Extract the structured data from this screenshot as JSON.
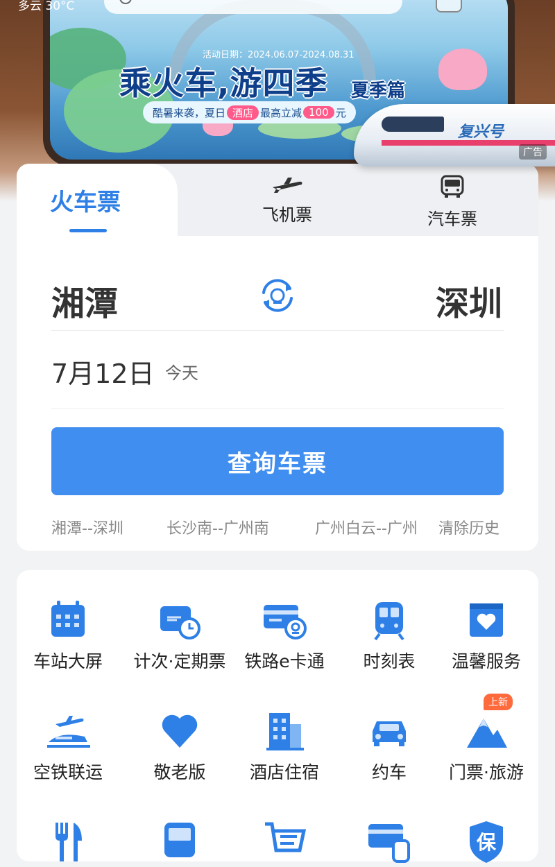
{
  "status": {
    "weather": "多云 30°C"
  },
  "banner": {
    "date_range": "活动日期：2024.06.07-2024.08.31",
    "title": "乘火车,游四季",
    "season": "夏季篇",
    "sub_prefix": "酷暑来袭，夏日",
    "sub_pill1": "酒店",
    "sub_mid": "最高立减",
    "sub_pill2": "100",
    "sub_suffix": "元",
    "train_label": "复兴号",
    "ad_tag": "广告"
  },
  "tabs": {
    "train": "火车票",
    "plane": "飞机票",
    "bus": "汽车票"
  },
  "booking": {
    "from": "湘潭",
    "to": "深圳",
    "date": "7月12日",
    "date_hint": "今天",
    "search_label": "查询车票",
    "history": [
      "湘潭--深圳",
      "长沙南--广州南",
      "广州白云--广州"
    ],
    "clear_history": "清除历史"
  },
  "services": [
    {
      "label": "车站大屏",
      "icon": "calendar-icon"
    },
    {
      "label": "计次·定期票",
      "icon": "ticket-clock-icon"
    },
    {
      "label": "铁路e卡通",
      "icon": "railway-card-icon"
    },
    {
      "label": "时刻表",
      "icon": "train-front-icon"
    },
    {
      "label": "温馨服务",
      "icon": "heart-box-icon"
    },
    {
      "label": "空铁联运",
      "icon": "plane-train-icon"
    },
    {
      "label": "敬老版",
      "icon": "heart-icon"
    },
    {
      "label": "酒店住宿",
      "icon": "building-icon"
    },
    {
      "label": "约车",
      "icon": "car-icon"
    },
    {
      "label": "门票·旅游",
      "icon": "mountain-icon",
      "badge": "上新"
    },
    {
      "label": "",
      "icon": "fork-knife-icon"
    },
    {
      "label": "",
      "icon": "bus-icon"
    },
    {
      "label": "",
      "icon": "cart-icon"
    },
    {
      "label": "",
      "icon": "card-train-icon"
    },
    {
      "label": "",
      "icon": "shield-bao-icon",
      "icon_text": "保"
    }
  ],
  "colors": {
    "accent": "#3f8ef0",
    "icon": "#2f80e6",
    "badge": "#ff6a3d"
  }
}
